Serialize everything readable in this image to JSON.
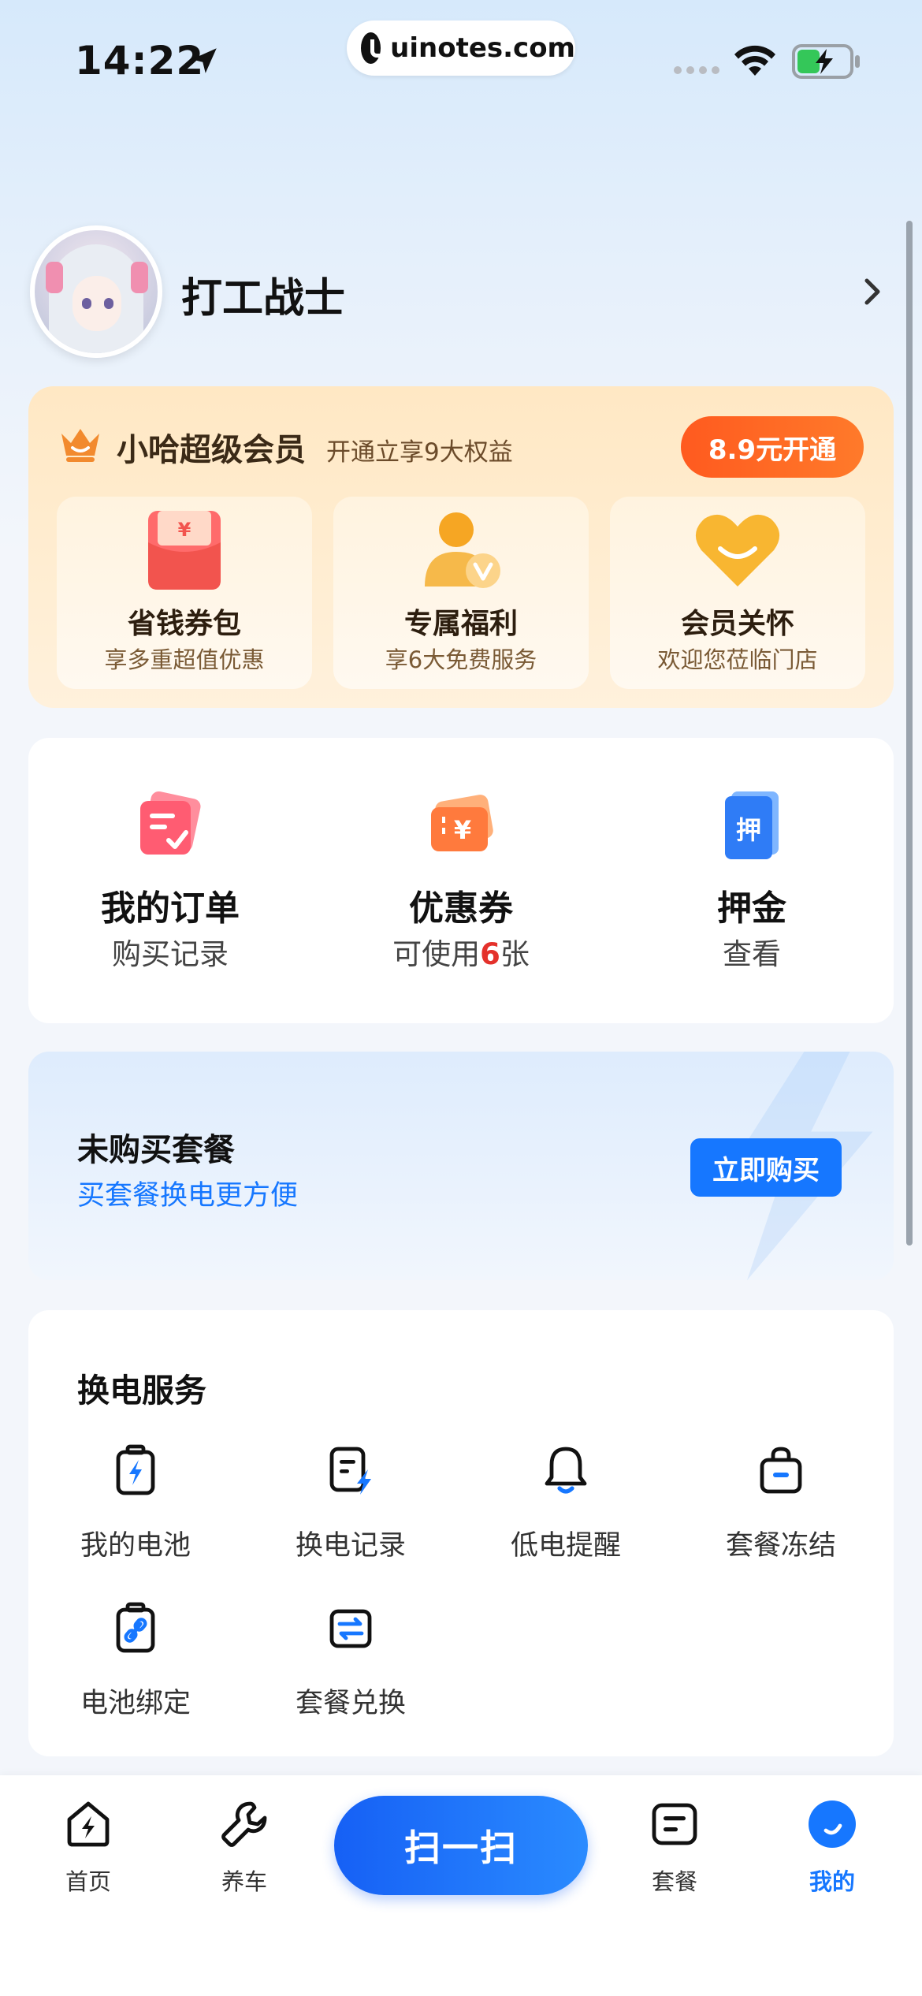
{
  "status_bar": {
    "time": "14:22",
    "url": "uinotes.com"
  },
  "profile": {
    "username": "打工战士"
  },
  "vip": {
    "title": "小哈超级会员",
    "subtitle": "开通立享9大权益",
    "button": "8.9元开通",
    "tiles": [
      {
        "title": "省钱券包",
        "subtitle": "享多重超值优惠",
        "icon": "red-envelope-icon"
      },
      {
        "title": "专属福利",
        "subtitle": "享6大免费服务",
        "icon": "vip-user-icon"
      },
      {
        "title": "会员关怀",
        "subtitle": "欢迎您莅临门店",
        "icon": "smile-heart-icon"
      }
    ]
  },
  "quick": {
    "orders": {
      "title": "我的订单",
      "subtitle": "购买记录"
    },
    "coupons": {
      "title": "优惠券",
      "subtitle_prefix": "可使用",
      "count": "6",
      "subtitle_suffix": "张"
    },
    "deposit": {
      "title": "押金",
      "subtitle": "查看",
      "icon_char": "押"
    }
  },
  "package": {
    "title": "未购买套餐",
    "subtitle": "买套餐换电更方便",
    "button": "立即购买"
  },
  "services": {
    "heading": "换电服务",
    "items": [
      {
        "label": "我的电池",
        "icon": "battery-icon"
      },
      {
        "label": "换电记录",
        "icon": "swap-record-icon"
      },
      {
        "label": "低电提醒",
        "icon": "bell-icon"
      },
      {
        "label": "套餐冻结",
        "icon": "package-freeze-icon"
      },
      {
        "label": "电池绑定",
        "icon": "battery-bind-icon"
      },
      {
        "label": "套餐兑换",
        "icon": "package-exchange-icon"
      }
    ]
  },
  "tab_bar": {
    "home": "首页",
    "car": "养车",
    "scan": "扫一扫",
    "package": "套餐",
    "mine": "我的",
    "active": "mine"
  },
  "colors": {
    "accent": "#1677ff",
    "vip_orange": "#ff5a1f",
    "red": "#e4312b"
  }
}
